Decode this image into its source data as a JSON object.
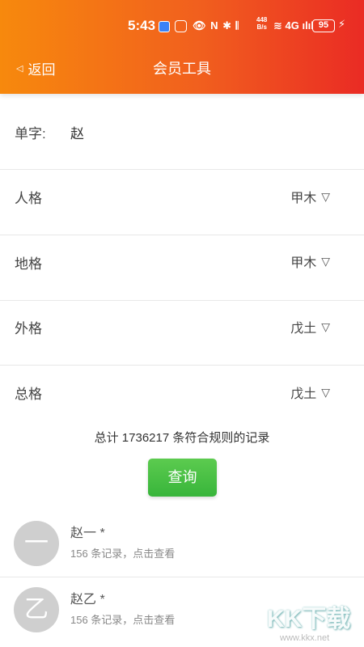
{
  "status_bar": {
    "time": "5:43",
    "icons_text": "👁 N ✱ 𝄃 ",
    "speed_value": "448",
    "speed_unit": "B/s",
    "signal_text": "≋ 4G ılıl",
    "battery": "95",
    "charge_icon": "⚡"
  },
  "header": {
    "back_icon": "◁",
    "back_label": "返回",
    "title": "会员工具"
  },
  "form": {
    "single_char": {
      "label": "单字:",
      "value": "赵"
    },
    "renge": {
      "label": "人格",
      "value": "甲木"
    },
    "dige": {
      "label": "地格",
      "value": "甲木"
    },
    "waige": {
      "label": "外格",
      "value": "戊土"
    },
    "zongge": {
      "label": "总格",
      "value": "戊土"
    },
    "dropdown_arrow": "▽"
  },
  "summary": {
    "total_text": "总计 1736217 条符合规则的记录",
    "query_button": "查询"
  },
  "results": [
    {
      "avatar": "一",
      "title": "赵一 *",
      "subtitle": "156 条记录，点击查看"
    },
    {
      "avatar": "乙",
      "title": "赵乙 *",
      "subtitle": "156 条记录，点击查看"
    }
  ],
  "watermark": {
    "text": "KK下载",
    "url": "www.kkx.net"
  }
}
